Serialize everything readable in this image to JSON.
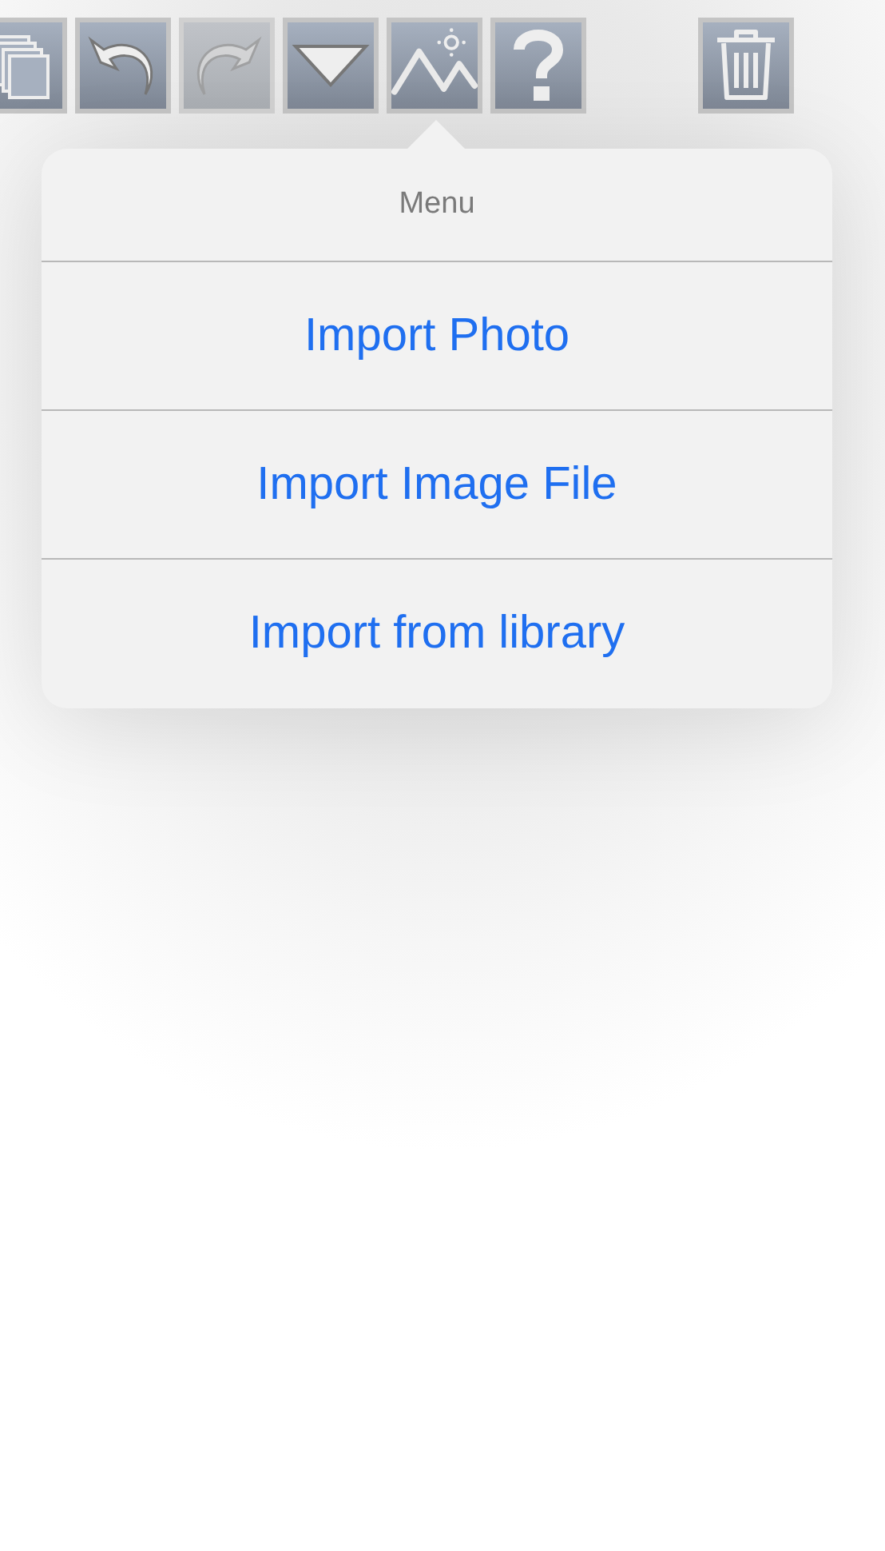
{
  "toolbar": {
    "buttons": [
      {
        "kind": "pages",
        "disabled": false
      },
      {
        "kind": "undo",
        "disabled": false
      },
      {
        "kind": "redo",
        "disabled": true
      },
      {
        "kind": "dropdown",
        "disabled": false
      },
      {
        "kind": "image",
        "disabled": false
      },
      {
        "kind": "help",
        "disabled": false
      },
      {
        "kind": "trash",
        "disabled": false
      }
    ]
  },
  "menu": {
    "title": "Menu",
    "items": [
      "Import Photo",
      "Import Image File",
      "Import from library"
    ]
  }
}
